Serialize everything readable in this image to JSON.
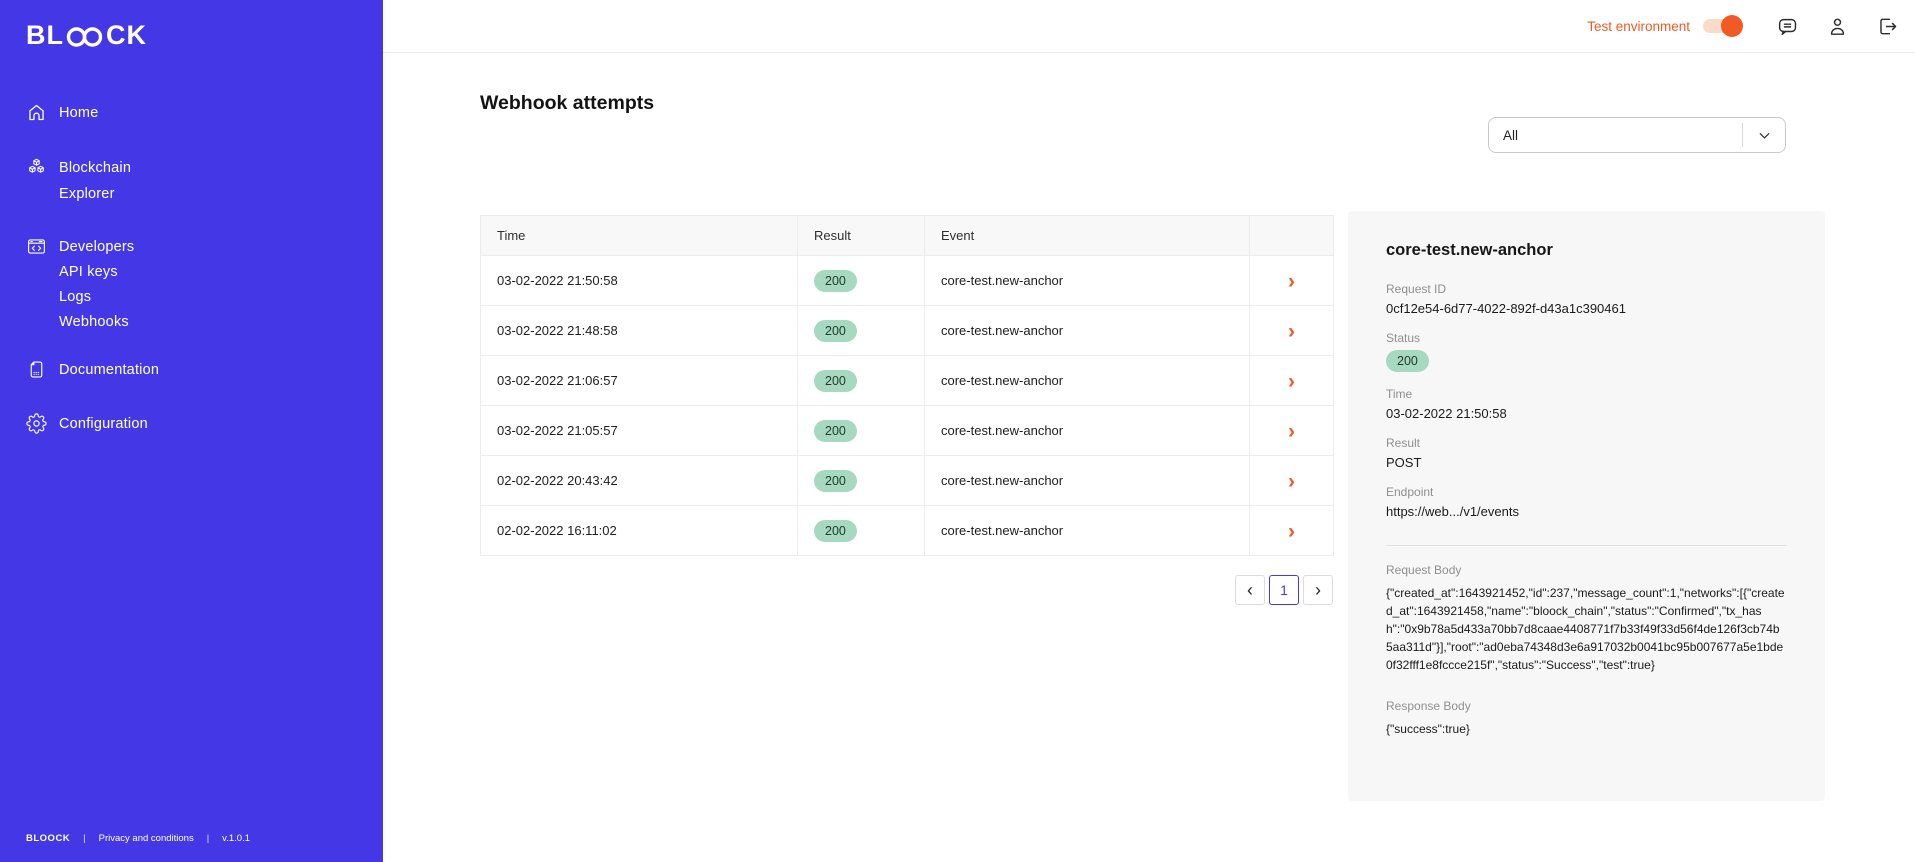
{
  "colors": {
    "brand_blue": "#4438e6",
    "accent_orange": "#f15a24",
    "pill_green_bg": "#a6d9bf",
    "pill_green_text": "#203a2c",
    "panel_bg": "#f7f7f7"
  },
  "sidebar": {
    "logo_prefix": "BL",
    "logo_suffix": "CK",
    "items": {
      "home": "Home",
      "blockchain_explorer": "Blockchain Explorer",
      "developers": "Developers",
      "api_keys": "API keys",
      "logs": "Logs",
      "webhooks": "Webhooks",
      "documentation": "Documentation",
      "configuration": "Configuration"
    },
    "footer": {
      "brand": "BLOOCK",
      "sep1": "|",
      "privacy": "Privacy and conditions",
      "sep2": "|",
      "version": "v.1.0.1"
    }
  },
  "topbar": {
    "environment_label": "Test environment"
  },
  "main": {
    "title": "Webhook attempts",
    "filter": {
      "value": "All"
    },
    "table": {
      "columns": {
        "time": "Time",
        "result": "Result",
        "event": "Event"
      },
      "row_action": "›",
      "rows": [
        {
          "time": "03-02-2022 21:50:58",
          "result": "200",
          "event": "core-test.new-anchor"
        },
        {
          "time": "03-02-2022 21:48:58",
          "result": "200",
          "event": "core-test.new-anchor"
        },
        {
          "time": "03-02-2022 21:06:57",
          "result": "200",
          "event": "core-test.new-anchor"
        },
        {
          "time": "03-02-2022 21:05:57",
          "result": "200",
          "event": "core-test.new-anchor"
        },
        {
          "time": "02-02-2022 20:43:42",
          "result": "200",
          "event": "core-test.new-anchor"
        },
        {
          "time": "02-02-2022 16:11:02",
          "result": "200",
          "event": "core-test.new-anchor"
        }
      ]
    },
    "pagination": {
      "prev": "‹",
      "current": "1",
      "next": "›"
    }
  },
  "detail": {
    "title": "core-test.new-anchor",
    "request_id_label": "Request ID",
    "request_id": "0cf12e54-6d77-4022-892f-d43a1c390461",
    "status_label": "Status",
    "status": "200",
    "time_label": "Time",
    "time": "03-02-2022 21:50:58",
    "result_label": "Result",
    "result": "POST",
    "endpoint_label": "Endpoint",
    "endpoint": "https://web.../v1/events",
    "request_body_label": "Request Body",
    "request_body": "{\"created_at\":1643921452,\"id\":237,\"message_count\":1,\"networks\":[{\"created_at\":1643921458,\"name\":\"bloock_chain\",\"status\":\"Confirmed\",\"tx_hash\":\"0x9b78a5d433a70bb7d8caae4408771f7b33f49f33d56f4de126f3cb74b5aa311d\"}],\"root\":\"ad0eba74348d3e6a917032b0041bc95b007677a5e1bde0f32fff1e8fccce215f\",\"status\":\"Success\",\"test\":true}",
    "response_body_label": "Response Body",
    "response_body": "{\"success\":true}"
  }
}
